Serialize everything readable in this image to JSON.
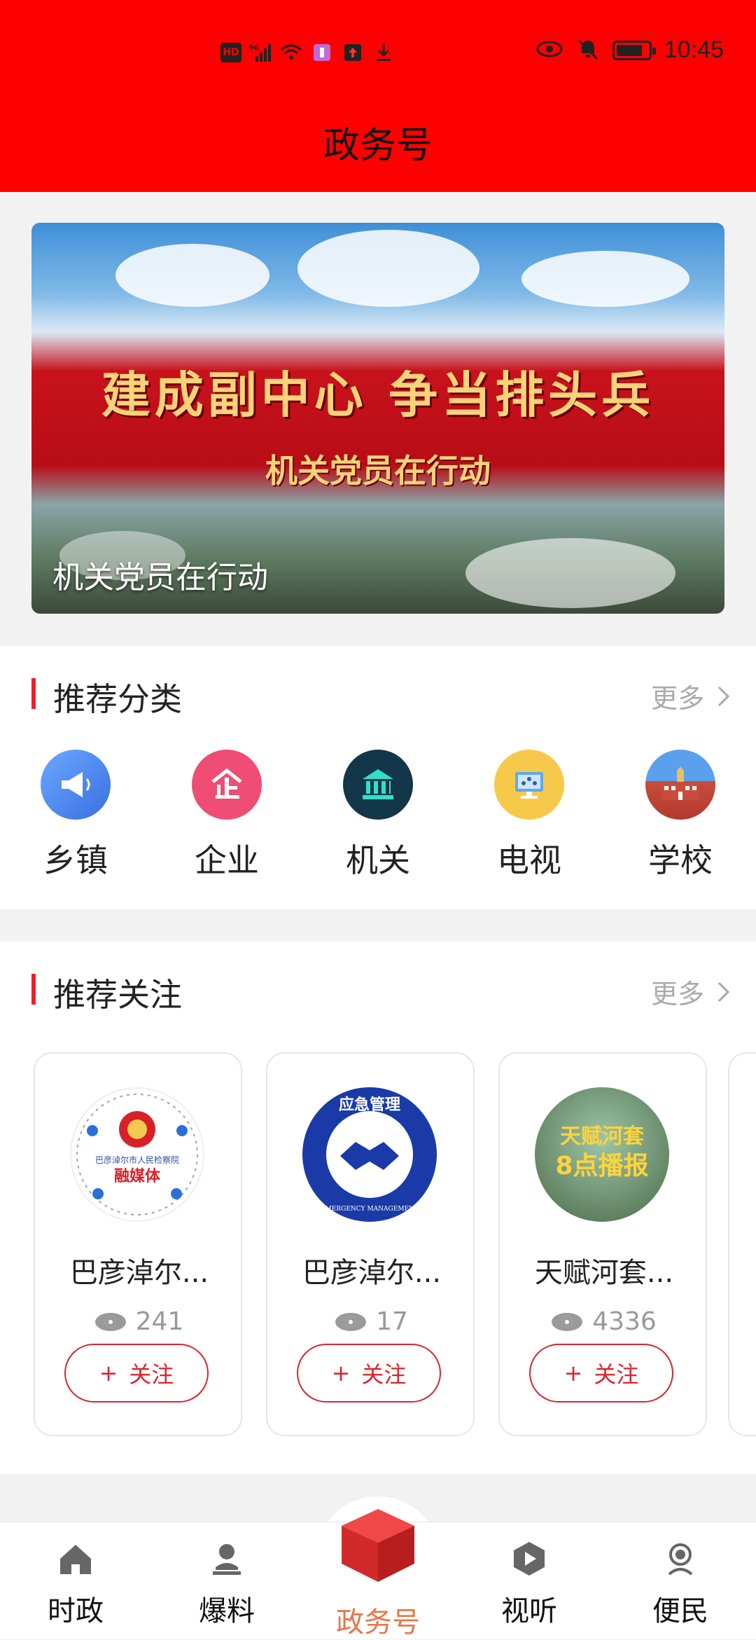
{
  "status_bar": {
    "time": "10:45",
    "signal_label": "5G",
    "hd_label": "HD",
    "colors": {
      "background": "#ff0000"
    }
  },
  "header": {
    "title": "政务号"
  },
  "banner": {
    "headline": "建成副中心 争当排头兵",
    "subtitle": "机关党员在行动",
    "caption": "机关党员在行动"
  },
  "recommended_categories": {
    "title": "推荐分类",
    "more_label": "更多",
    "items": [
      {
        "label": "乡镇",
        "icon": "megaphone-icon",
        "color": "#4a87f0"
      },
      {
        "label": "企业",
        "icon": "enterprise-icon",
        "color": "#ef4d73"
      },
      {
        "label": "机关",
        "icon": "government-building-icon",
        "color": "#14364a"
      },
      {
        "label": "电视",
        "icon": "tv-monitor-icon",
        "color": "#f7c94a"
      },
      {
        "label": "学校",
        "icon": "school-building-icon",
        "color": "#3d7fd6"
      }
    ]
  },
  "recommended_follow": {
    "title": "推荐关注",
    "more_label": "更多",
    "follow_label": "关注",
    "follow_plus": "+",
    "cards": [
      {
        "name": "巴彦淖尔...",
        "views": "241",
        "logo_text_top": "巴彦淖尔市人民检察院",
        "logo_text_bottom": "融媒体"
      },
      {
        "name": "巴彦淖尔...",
        "views": "17",
        "logo_text_top": "应急管理",
        "logo_text_bottom": "EMERGENCY MANAGEMENT"
      },
      {
        "name": "天赋河套...",
        "views": "4336",
        "logo_text_top": "天赋河套",
        "logo_text_bottom": "8点播报"
      }
    ]
  },
  "tabbar": {
    "accent_color": "#e8764a",
    "items": [
      {
        "label": "时政",
        "icon": "home-icon",
        "active": false
      },
      {
        "label": "爆料",
        "icon": "person-stamp-icon",
        "active": false
      },
      {
        "label": "政务号",
        "icon": "red-cube-icon",
        "active": true
      },
      {
        "label": "视听",
        "icon": "play-hexagon-icon",
        "active": false
      },
      {
        "label": "便民",
        "icon": "service-person-icon",
        "active": false
      }
    ]
  }
}
